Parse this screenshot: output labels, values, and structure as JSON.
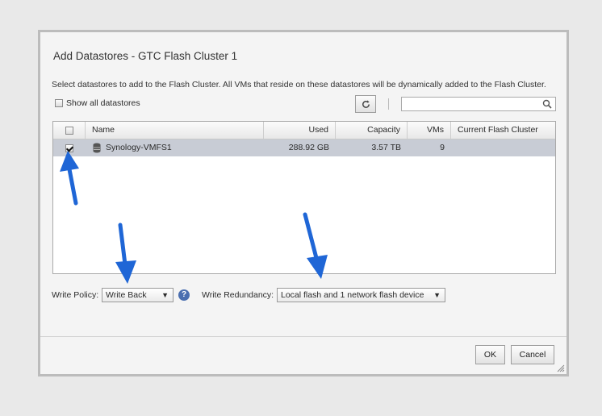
{
  "dialog": {
    "title": "Add Datastores - GTC Flash Cluster 1",
    "description": "Select datastores to add to the Flash Cluster. All VMs that reside on these datastores will be dynamically added to the Flash Cluster.",
    "show_all_label": "Show all datastores",
    "search_value": ""
  },
  "table": {
    "columns": [
      "Name",
      "Used",
      "Capacity",
      "VMs",
      "Current Flash Cluster"
    ],
    "rows": [
      {
        "checked": true,
        "name": "Synology-VMFS1",
        "used": "288.92 GB",
        "capacity": "3.57 TB",
        "vms": "9",
        "current_flash_cluster": ""
      }
    ]
  },
  "write_policy": {
    "label": "Write Policy:",
    "value": "Write Back",
    "help": "?"
  },
  "write_redundancy": {
    "label": "Write Redundancy:",
    "value": "Local flash and 1 network flash device"
  },
  "buttons": {
    "ok": "OK",
    "cancel": "Cancel"
  },
  "colors": {
    "selected_row": "#c8ccd5",
    "annotation_arrow": "#1f66d6",
    "help_icon": "#4b6fb0"
  }
}
